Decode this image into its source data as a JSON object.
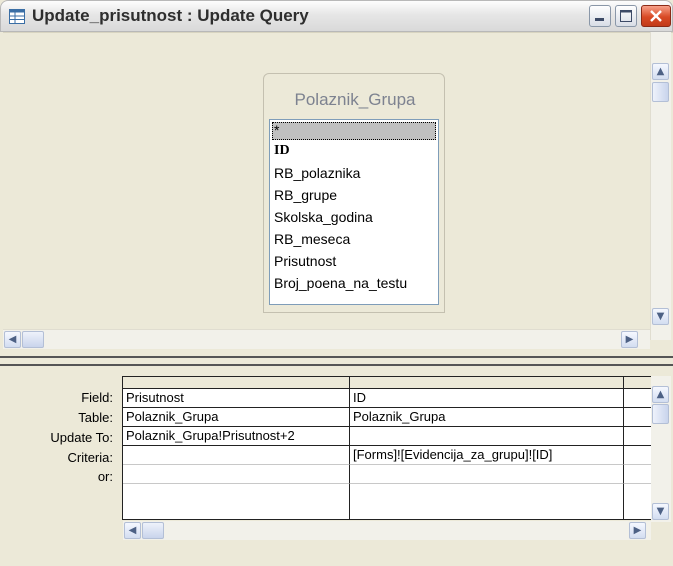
{
  "window": {
    "title": "Update_prisutnost : Update Query",
    "icon": "query-icon"
  },
  "table_box": {
    "title": "Polaznik_Grupa",
    "fields": [
      "*",
      "ID",
      "RB_polaznika",
      "RB_grupe",
      "Skolska_godina",
      "RB_meseca",
      "Prisutnost",
      "Broj_poena_na_testu"
    ]
  },
  "grid": {
    "row_labels": [
      "Field:",
      "Table:",
      "Update To:",
      "Criteria:",
      "or:"
    ],
    "columns": [
      {
        "field": "Prisutnost",
        "table": "Polaznik_Grupa",
        "update_to": "Polaznik_Grupa!Prisutnost+2",
        "criteria": "",
        "or": ""
      },
      {
        "field": "ID",
        "table": "Polaznik_Grupa",
        "update_to": "",
        "criteria": "[Forms]![Evidencija_za_grupu]![ID]",
        "or": ""
      }
    ]
  },
  "colors": {
    "window_bg": "#ece9d8",
    "close_button": "#d84a25",
    "scroll_accent": "#4d6185"
  }
}
